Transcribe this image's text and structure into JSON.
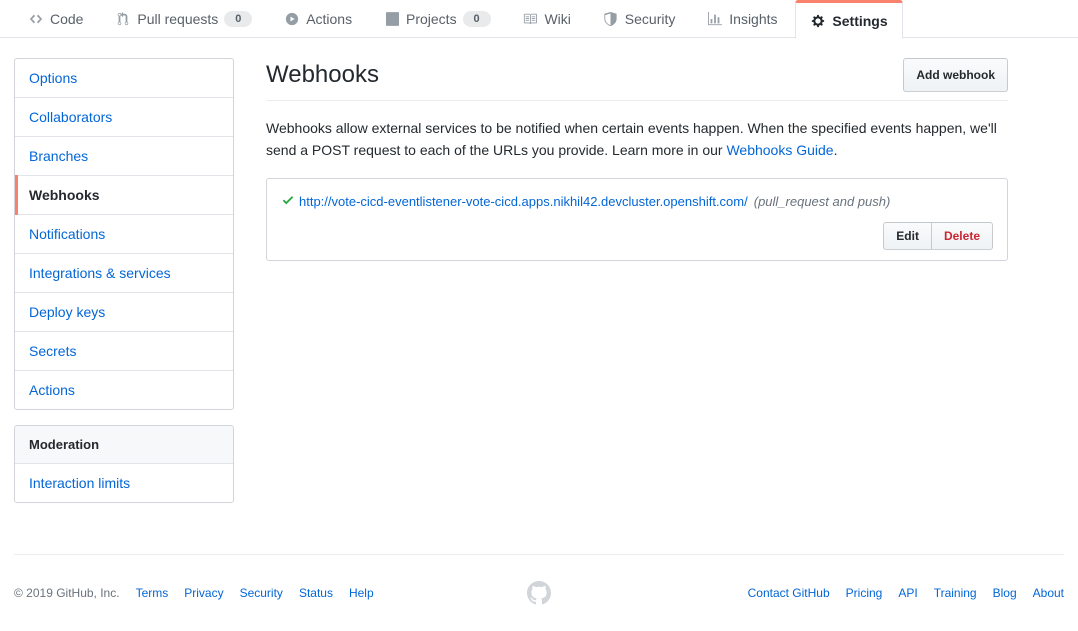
{
  "repo_nav": {
    "tabs": [
      {
        "label": "Code",
        "icon": "code-icon",
        "counter": null,
        "selected": false
      },
      {
        "label": "Pull requests",
        "icon": "git-pull-request-icon",
        "counter": "0",
        "selected": false
      },
      {
        "label": "Actions",
        "icon": "play-icon",
        "counter": null,
        "selected": false
      },
      {
        "label": "Projects",
        "icon": "project-icon",
        "counter": "0",
        "selected": false
      },
      {
        "label": "Wiki",
        "icon": "book-icon",
        "counter": null,
        "selected": false
      },
      {
        "label": "Security",
        "icon": "shield-icon",
        "counter": null,
        "selected": false
      },
      {
        "label": "Insights",
        "icon": "graph-icon",
        "counter": null,
        "selected": false
      },
      {
        "label": "Settings",
        "icon": "gear-icon",
        "counter": null,
        "selected": true
      }
    ],
    "selected_accent": "#f9826c"
  },
  "sidebar": {
    "groups": [
      {
        "heading": null,
        "items": [
          {
            "label": "Options",
            "selected": false
          },
          {
            "label": "Collaborators",
            "selected": false
          },
          {
            "label": "Branches",
            "selected": false
          },
          {
            "label": "Webhooks",
            "selected": true
          },
          {
            "label": "Notifications",
            "selected": false
          },
          {
            "label": "Integrations & services",
            "selected": false
          },
          {
            "label": "Deploy keys",
            "selected": false
          },
          {
            "label": "Secrets",
            "selected": false
          },
          {
            "label": "Actions",
            "selected": false
          }
        ]
      },
      {
        "heading": "Moderation",
        "items": [
          {
            "label": "Interaction limits",
            "selected": false
          }
        ]
      }
    ]
  },
  "main": {
    "title": "Webhooks",
    "add_button": "Add webhook",
    "intro_part1": "Webhooks allow external services to be notified when certain events happen. When the specified events happen, we'll send a POST request to each of the URLs you provide. Learn more in our ",
    "intro_link": "Webhooks Guide",
    "intro_part2": ".",
    "webhooks": [
      {
        "status_icon": "check-icon",
        "status_color": "#28a745",
        "url": "http://vote-cicd-eventlistener-vote-cicd.apps.nikhil42.devcluster.openshift.com/",
        "events": "(pull_request and push)",
        "edit_label": "Edit",
        "delete_label": "Delete"
      }
    ]
  },
  "footer": {
    "copyright": "© 2019 GitHub, Inc.",
    "left_links": [
      "Terms",
      "Privacy",
      "Security",
      "Status",
      "Help"
    ],
    "mark_icon": "github-mark-icon",
    "right_links": [
      "Contact GitHub",
      "Pricing",
      "API",
      "Training",
      "Blog",
      "About"
    ]
  }
}
